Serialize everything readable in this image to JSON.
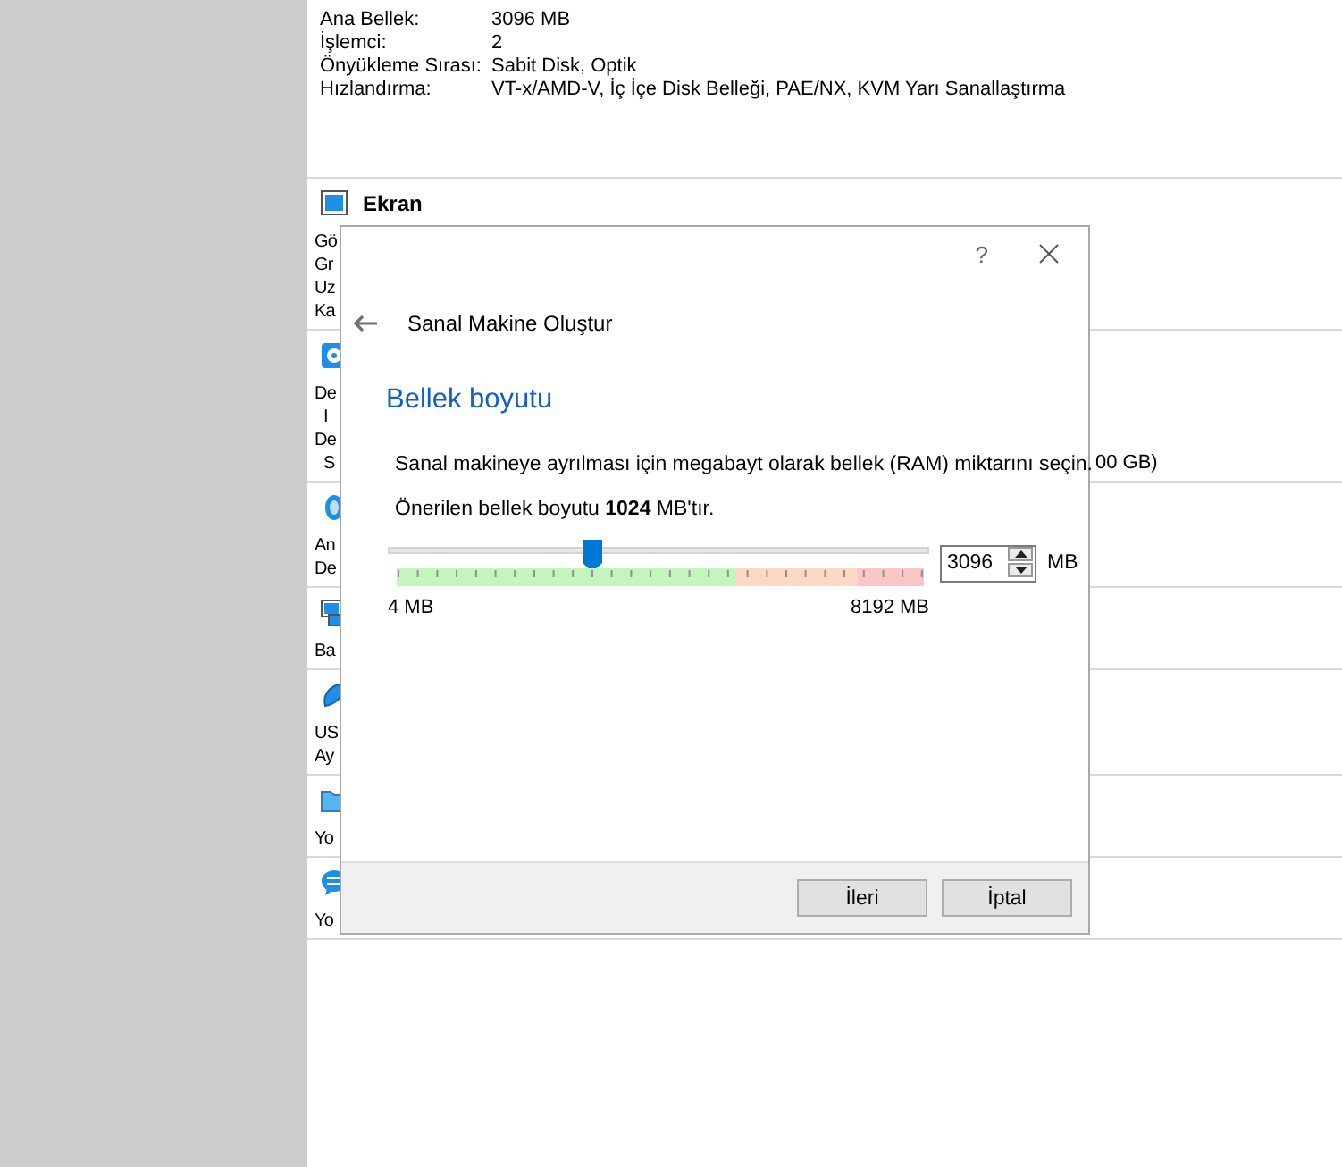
{
  "system": {
    "rows": [
      {
        "label": "Ana Bellek:",
        "value": "3096 MB"
      },
      {
        "label": "İşlemci:",
        "value": "2"
      },
      {
        "label": "Önyükleme Sırası:",
        "value": "Sabit Disk, Optik"
      },
      {
        "label": "Hızlandırma:",
        "value": "VT-x/AMD-V, İç İçe Disk Belleği, PAE/NX, KVM Yarı Sanallaştırma"
      }
    ]
  },
  "sections": [
    {
      "kind": "display",
      "title": "Ekran",
      "lines": [
        {
          "text": "Gö",
          "indent": false
        },
        {
          "text": "Gr",
          "indent": false
        },
        {
          "text": "Uz",
          "indent": false
        },
        {
          "text": "Ka",
          "indent": false
        }
      ]
    },
    {
      "kind": "storage",
      "lines": [
        {
          "text": "De",
          "indent": false
        },
        {
          "text": "I",
          "indent": true
        },
        {
          "text": "De",
          "indent": false
        },
        {
          "text": "S",
          "indent": true,
          "value": "00 GB)"
        }
      ]
    },
    {
      "kind": "audio",
      "lines": [
        {
          "text": "An",
          "indent": false
        },
        {
          "text": "De",
          "indent": false
        }
      ]
    },
    {
      "kind": "network",
      "lines": [
        {
          "text": "Ba",
          "indent": false
        }
      ]
    },
    {
      "kind": "usb",
      "lines": [
        {
          "text": "US",
          "indent": false
        },
        {
          "text": "Ay",
          "indent": false
        }
      ]
    },
    {
      "kind": "folder",
      "lines": [
        {
          "text": "Yo",
          "indent": false
        }
      ]
    },
    {
      "kind": "description",
      "lines": [
        {
          "text": "Yo",
          "indent": false
        }
      ]
    }
  ],
  "dialog": {
    "help": "?",
    "title": "Sanal Makine Oluştur",
    "heading": "Bellek boyutu",
    "description": "Sanal makineye ayrılması için megabayt olarak bellek (RAM) miktarını seçin.",
    "recommendation": "Önerilen bellek boyutu **1024** MB'tır.",
    "slider": {
      "level": 0.378,
      "min_label": "4 MB",
      "max_label": "8192 MB"
    },
    "spinbox": {
      "value": "3096",
      "unit": "MB"
    },
    "buttons": [
      "İleri",
      "İptal"
    ]
  }
}
